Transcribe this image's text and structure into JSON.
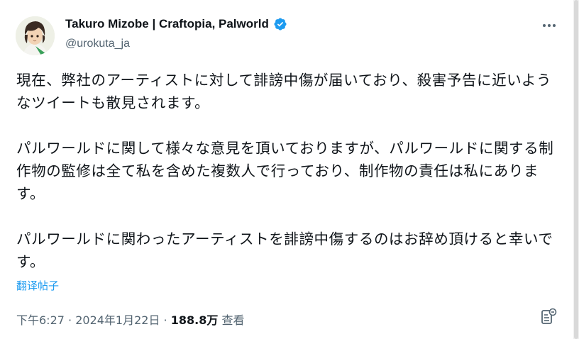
{
  "author": {
    "display_name": "Takuro Mizobe | Craftopia, Palworld",
    "handle": "@urokuta_ja",
    "verified_icon": "verified-badge-icon",
    "badge_color": "#1d9bf0"
  },
  "tweet": {
    "text": "現在、弊社のアーティストに対して誹謗中傷が届いており、殺害予告に近いようなツイートも散見されます。\n\nパルワールドに関して様々な意見を頂いておりますが、パルワールドに関する制作物の監修は全て私を含めた複数人で行っており、制作物の責任は私にあります。\n\nパルワールドに関わったアーティストを誹謗中傷するのはお辞め頂けると幸いです。",
    "translate_label": "翻译帖子"
  },
  "meta": {
    "time": "下午6:27",
    "separator1": " · ",
    "date": "2024年1月22日",
    "separator2": " · ",
    "views_count": "188.8万",
    "views_label": " 查看"
  },
  "icons": {
    "more": "more-horizontal-icon",
    "bookmark": "bookmark-icon"
  },
  "colors": {
    "text": "#0f1419",
    "secondary": "#536471",
    "link": "#1d9bf0"
  }
}
